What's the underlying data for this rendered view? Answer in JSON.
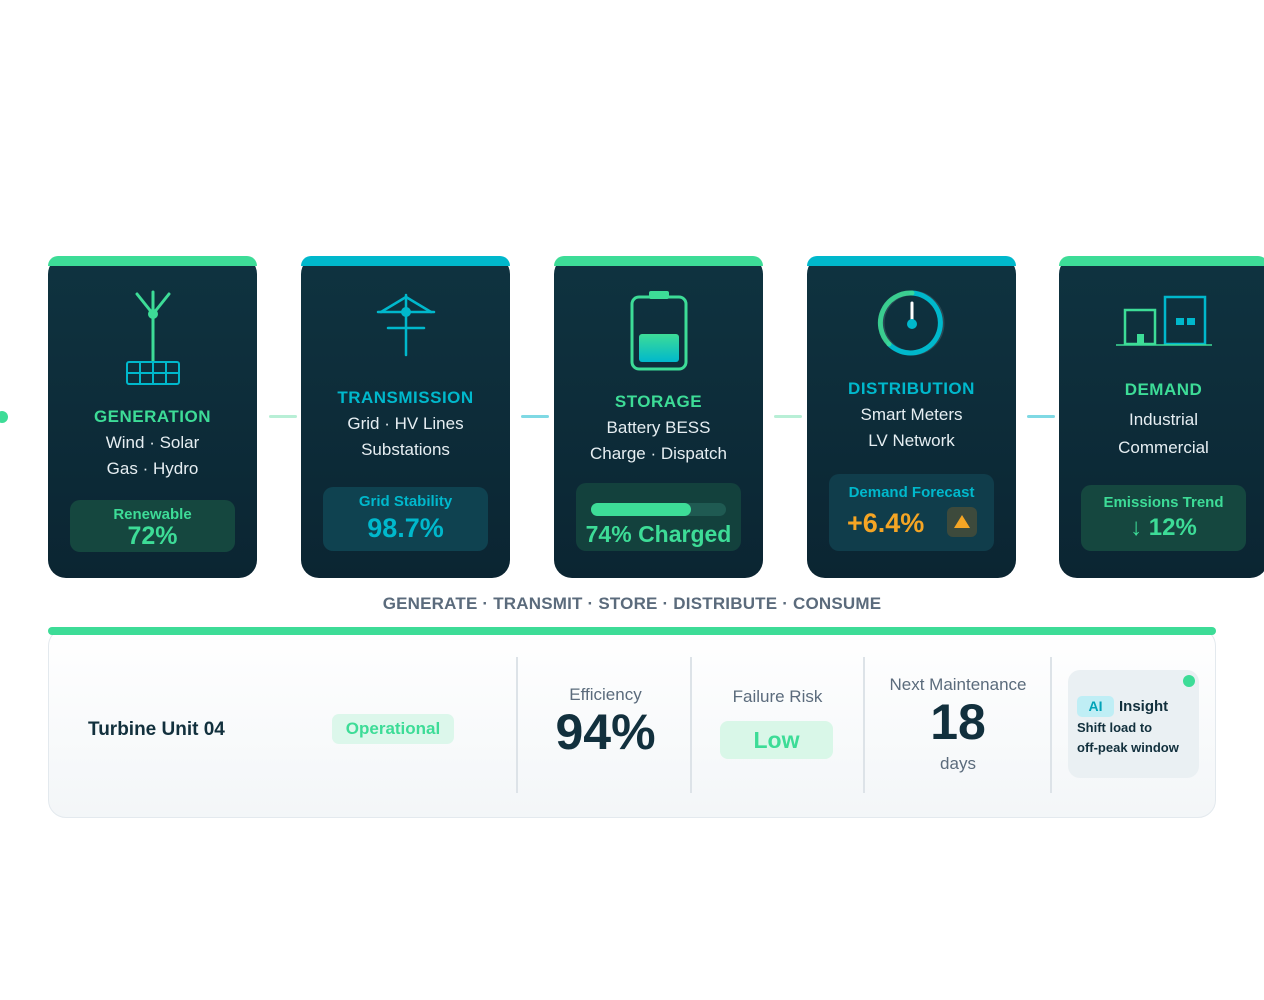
{
  "pipeline": {
    "caption": "GENERATE · TRANSMIT · STORE · DISTRIBUTE · CONSUME",
    "cards": [
      {
        "title": "GENERATION",
        "line1": "Wind · Solar",
        "line2": "Gas · Hydro",
        "metric_label": "Renewable",
        "metric_value": "72%",
        "accent": "#3ddc97",
        "icon": "wind-turbine-solar-icon"
      },
      {
        "title": "TRANSMISSION",
        "line1": "Grid · HV Lines",
        "line2": "Substations",
        "metric_label": "Grid Stability",
        "metric_value": "98.7%",
        "accent": "#00b8cc",
        "icon": "transmission-tower-icon"
      },
      {
        "title": "STORAGE",
        "line1": "Battery BESS",
        "line2": "Charge · Dispatch",
        "metric_value": "74% Charged",
        "charge_level": 0.74,
        "accent": "#3ddc97",
        "icon": "battery-icon"
      },
      {
        "title": "DISTRIBUTION",
        "line1": "Smart Meters",
        "line2": "LV Network",
        "metric_label": "Demand Forecast",
        "metric_value": "+6.4%",
        "accent": "#00b8cc",
        "warn_color": "#f5a524",
        "icon": "smart-meter-gauge-icon"
      },
      {
        "title": "DEMAND",
        "line1": "Industrial",
        "line2": "Commercial",
        "metric_label": "Emissions Trend",
        "metric_value": "↓ 12%",
        "accent": "#3ddc97",
        "icon": "buildings-icon"
      }
    ]
  },
  "asset_panel": {
    "name": "Turbine Unit 04",
    "status": "Operational",
    "efficiency_label": "Efficiency",
    "efficiency_value": "94%",
    "risk_label": "Failure Risk",
    "risk_value": "Low",
    "maintenance_label": "Next Maintenance",
    "maintenance_value": "18",
    "maintenance_unit": "days",
    "insight_badge": "AI",
    "insight_title": "Insight",
    "insight_line1": "Shift load to",
    "insight_line2": "off-peak window"
  },
  "colors": {
    "green": "#3ddc97",
    "cyan": "#00b8cc",
    "navy": "#0b2532",
    "amber": "#f5a524"
  }
}
